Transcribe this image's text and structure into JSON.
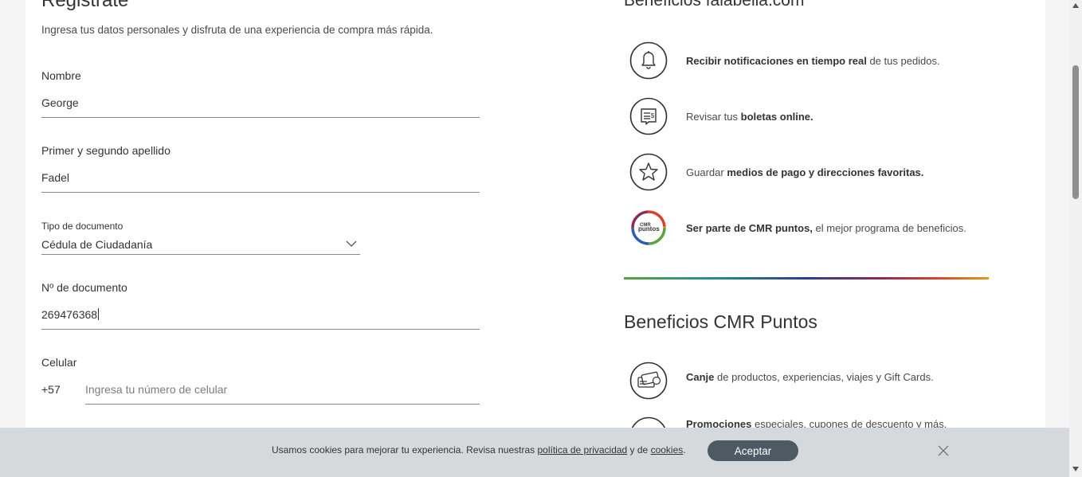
{
  "form": {
    "title": "Registrate",
    "subtitle": "Ingresa tus datos personales y disfruta de una experiencia de compra más rápida.",
    "nombre_label": "Nombre",
    "nombre_value": "George",
    "apellido_label": "Primer y segundo apellido",
    "apellido_value": "Fadel",
    "tipo_doc_label": "Tipo de documento",
    "tipo_doc_value": "Cédula de Ciudadanía",
    "num_doc_label": "Nº de documento",
    "num_doc_value": "269476368",
    "celular_label": "Celular",
    "celular_prefix": "+57",
    "celular_placeholder": "Ingresa tu número de celular"
  },
  "benefits_falabella": {
    "title": "Beneficios falabella.com",
    "items": [
      {
        "icon": "bell-icon",
        "bold": "Recibir notificaciones en tiempo real",
        "rest": " de tus pedidos."
      },
      {
        "icon": "receipt-icon",
        "pre": "Revisar tus ",
        "bold": "boletas online."
      },
      {
        "icon": "star-icon",
        "pre": "Guardar ",
        "bold": "medios de pago y direcciones favoritas."
      },
      {
        "icon": "cmr-puntos-logo",
        "logo_text_1": "CMR",
        "logo_text_2": "puntos",
        "bold": "Ser parte de CMR puntos,",
        "rest": " el mejor programa de beneficios."
      }
    ]
  },
  "benefits_cmr": {
    "title": "Beneficios CMR Puntos",
    "items": [
      {
        "icon": "gift-card-icon",
        "bold": "Canje",
        "rest": " de productos, experiencias, viajes y Gift Cards."
      },
      {
        "icon": "promo-icon",
        "bold": "Promociones",
        "rest": " especiales, cupones de descuento y más."
      }
    ]
  },
  "cookie": {
    "text_pre": "Usamos cookies para mejorar tu experiencia. Revisa nuestras ",
    "link_privacy": "política de privacidad",
    "text_mid": " y de ",
    "link_cookies": "cookies",
    "text_end": ".",
    "accept_label": "Aceptar"
  },
  "colors": {
    "accent_button": "#4d5a64",
    "icon_stroke": "#333333"
  }
}
